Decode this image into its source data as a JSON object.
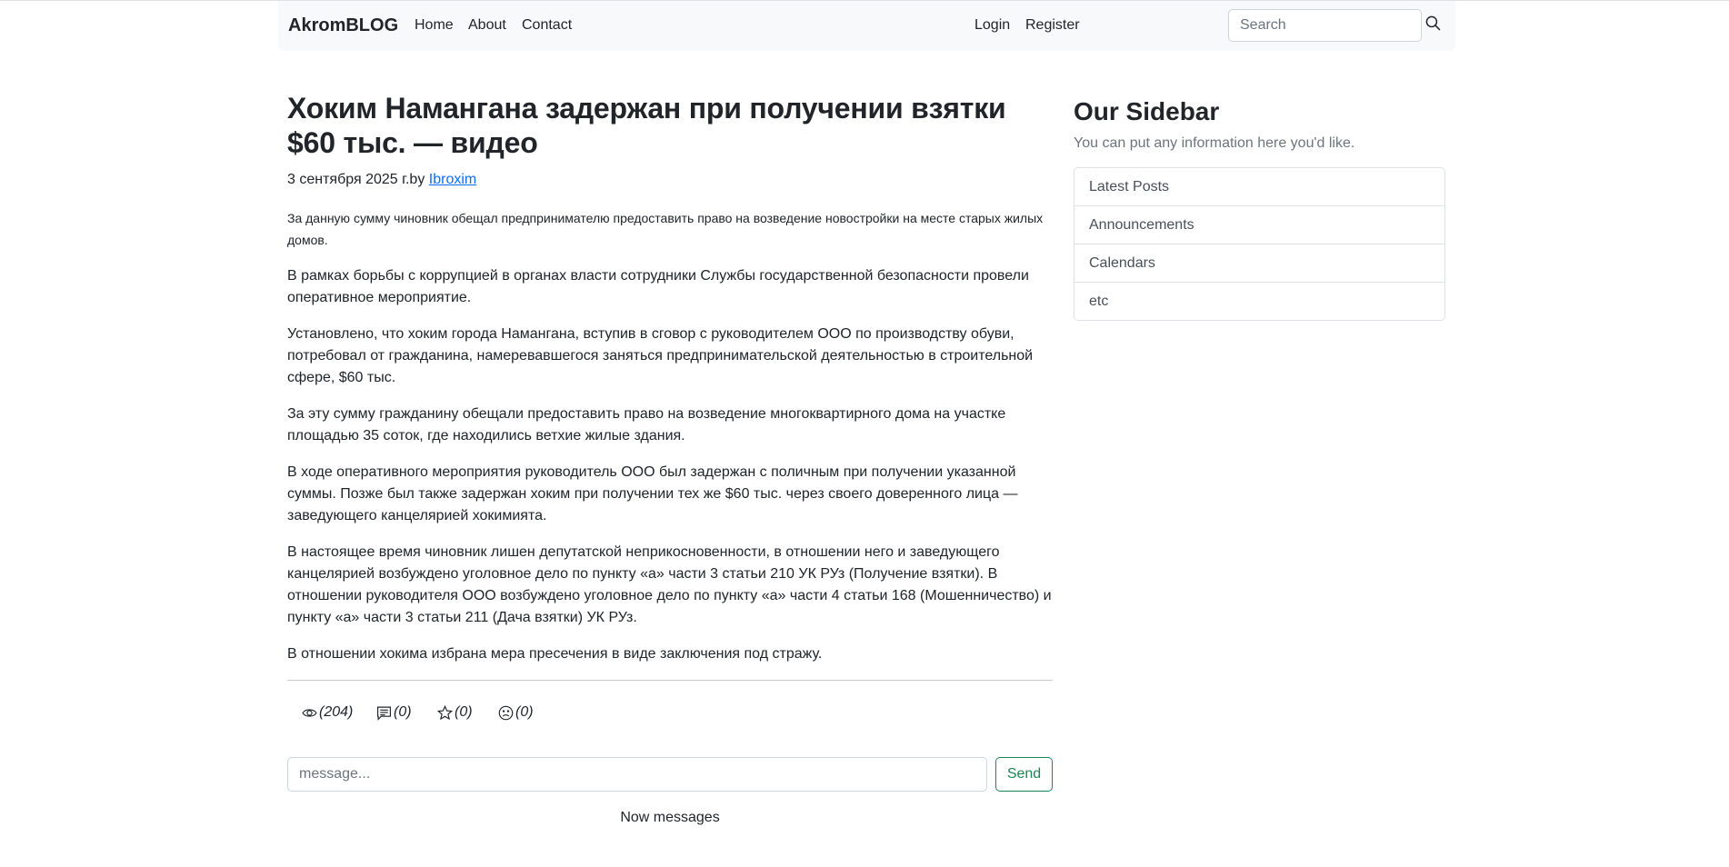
{
  "navbar": {
    "brand": "AkromBLOG",
    "links": [
      "Home",
      "About",
      "Contact"
    ],
    "auth": [
      "Login",
      "Register"
    ],
    "search_placeholder": "Search"
  },
  "article": {
    "title": "Хоким Намангана задержан при получении взятки $60 тыс. — видео",
    "date": "3 сентября 2025 г.by ",
    "author": "Ibroxim",
    "lead": "За данную сумму чиновник обещал предпринимателю предоставить право на возведение новостройки на месте старых жилых домов.",
    "paragraphs": [
      "В рамках борьбы с коррупцией в органах власти сотрудники Службы государственной безопасности провели оперативное мероприятие.",
      "Установлено, что хоким города Намангана, вступив в сговор с руководителем ООО по производству обуви, потребовал от гражданина, намеревавшегося заняться предпринимательской деятельностью в строительной сфере, $60 тыс.",
      "За эту сумму гражданину обещали предоставить право на возведение многоквартирного дома на участке площадью 35 соток, где находились ветхие жилые здания.",
      "В ходе оперативного мероприятия руководитель ООО был задержан с поличным при получении указанной суммы. Позже был также задержан хоким при получении тех же $60 тыс. через своего доверенного лица — заведующего канцелярией хокимията.",
      "В настоящее время чиновник лишен депутатской неприкосновенности, в отношении него и заведующего канцелярией возбуждено уголовное дело по пункту «а» части 3 статьи 210 УК РУз (Получение взятки). В отношении руководителя ООО возбуждено уголовное дело по пункту «а» части 4 статьи 168 (Мошенничество) и пункту «а» части 3 статьи 211 (Дача взятки) УК РУз.",
      "В отношении хокима избрана мера пресечения в виде заключения под стражу."
    ],
    "stats": {
      "views": "(204)",
      "comments": "(0)",
      "favorites": "(0)",
      "dislikes": "(0)"
    },
    "message_placeholder": "message...",
    "send_label": "Send",
    "now_messages": "Now messages"
  },
  "sidebar": {
    "title": "Our Sidebar",
    "text": "You can put any information here you'd like.",
    "items": [
      "Latest Posts",
      "Announcements",
      "Calendars",
      "etc"
    ]
  },
  "colors": {
    "link": "#0d6efd",
    "send_outline": "#198754",
    "navbar_bg": "#f8f9fa",
    "muted": "#6c757d"
  }
}
